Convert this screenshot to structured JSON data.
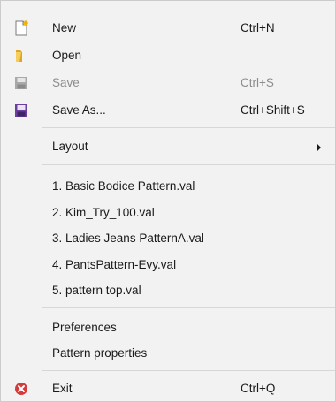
{
  "menu": {
    "new": {
      "label": "New",
      "shortcut": "Ctrl+N",
      "icon": "new-document-icon"
    },
    "open": {
      "label": "Open",
      "icon": "folder-icon"
    },
    "save": {
      "label": "Save",
      "shortcut": "Ctrl+S",
      "icon": "save-disk-icon",
      "enabled": false
    },
    "save_as": {
      "label": "Save As...",
      "shortcut": "Ctrl+Shift+S",
      "icon": "save-as-disk-icon"
    },
    "layout": {
      "label": "Layout",
      "icon": "submenu-arrow-icon"
    },
    "recent": [
      {
        "label": "1. Basic Bodice Pattern.val"
      },
      {
        "label": "2. Kim_Try_100.val"
      },
      {
        "label": "3. Ladies Jeans PatternA.val"
      },
      {
        "label": "4. PantsPattern-Evy.val"
      },
      {
        "label": "5. pattern top.val"
      }
    ],
    "preferences": {
      "label": "Preferences"
    },
    "pattern_properties": {
      "label": "Pattern properties"
    },
    "exit": {
      "label": "Exit",
      "shortcut": "Ctrl+Q",
      "icon": "exit-icon"
    }
  },
  "colors": {
    "background": "#f2f2f2",
    "text": "#1a1a1a",
    "disabled_text": "#8c8c8c",
    "exit_red": "#d63b3b"
  }
}
